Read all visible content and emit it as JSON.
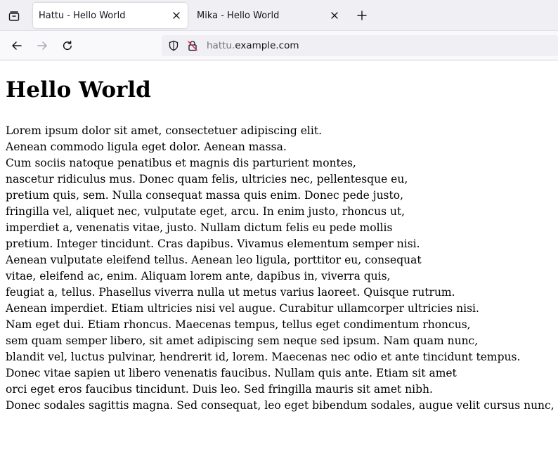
{
  "tabs": [
    {
      "title": "Hattu - Hello World",
      "active": true
    },
    {
      "title": "Mika - Hello World",
      "active": false
    }
  ],
  "tab_close_glyph": "✕",
  "new_tab_glyph": "+",
  "toolbar": {
    "icons": [
      "tab-list-icon",
      "back-arrow-icon",
      "forward-arrow-icon",
      "reload-icon",
      "shield-icon",
      "insecure-lock-icon",
      "close-icon",
      "plus-icon"
    ]
  },
  "urlbar": {
    "subdomain": "hattu.",
    "domain": "example.com"
  },
  "page": {
    "heading": "Hello World",
    "lines": [
      "Lorem ipsum dolor sit amet, consectetuer adipiscing elit.",
      "Aenean commodo ligula eget dolor. Aenean massa.",
      "Cum sociis natoque penatibus et magnis dis parturient montes,",
      "nascetur ridiculus mus. Donec quam felis, ultricies nec, pellentesque eu,",
      "pretium quis, sem. Nulla consequat massa quis enim. Donec pede justo,",
      "fringilla vel, aliquet nec, vulputate eget, arcu. In enim justo, rhoncus ut,",
      "imperdiet a, venenatis vitae, justo. Nullam dictum felis eu pede mollis",
      "pretium. Integer tincidunt. Cras dapibus. Vivamus elementum semper nisi.",
      "Aenean vulputate eleifend tellus. Aenean leo ligula, porttitor eu, consequat",
      "vitae, eleifend ac, enim. Aliquam lorem ante, dapibus in, viverra quis,",
      "feugiat a, tellus. Phasellus viverra nulla ut metus varius laoreet. Quisque rutrum.",
      "Aenean imperdiet. Etiam ultricies nisi vel augue. Curabitur ullamcorper ultricies nisi.",
      "Nam eget dui. Etiam rhoncus. Maecenas tempus, tellus eget condimentum rhoncus,",
      "sem quam semper libero, sit amet adipiscing sem neque sed ipsum. Nam quam nunc,",
      "blandit vel, luctus pulvinar, hendrerit id, lorem. Maecenas nec odio et ante tincidunt tempus.",
      "Donec vitae sapien ut libero venenatis faucibus. Nullam quis ante. Etiam sit amet",
      "orci eget eros faucibus tincidunt. Duis leo. Sed fringilla mauris sit amet nibh.",
      "Donec sodales sagittis magna. Sed consequat, leo eget bibendum sodales, augue velit cursus nunc,"
    ]
  },
  "colors": {
    "tabbar_bg": "#f0f0f4",
    "navbar_bg": "#f9f9fb",
    "urlbar_bg": "#f0f0f4",
    "text": "#15141a",
    "url_subdomain": "#737373",
    "insecure_slash": "#e22850"
  }
}
